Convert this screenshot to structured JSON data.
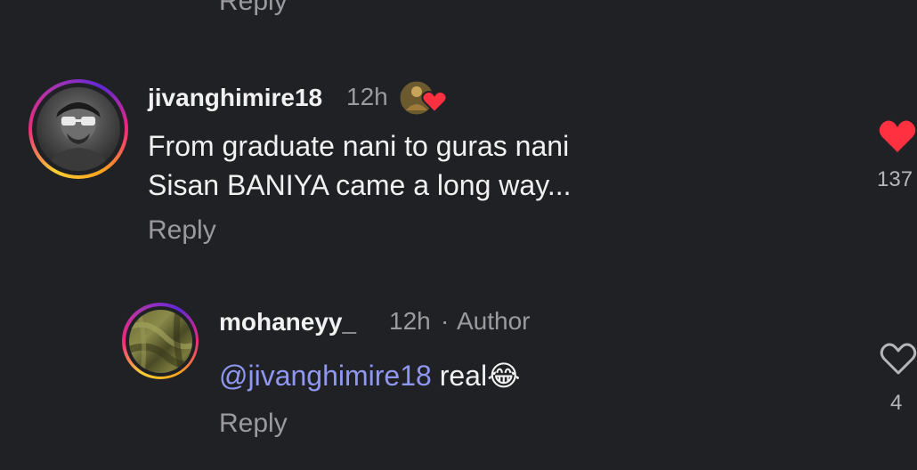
{
  "top": {
    "reply_label": "Reply"
  },
  "comment": {
    "username": "jivanghimire18",
    "time": "12h",
    "text_line1": "From graduate nani to guras nani",
    "text_line2": "Sisan BANIYA came a long way...",
    "reply_label": "Reply",
    "like_count": "137",
    "liked": true,
    "heart_color": "#ff3040"
  },
  "reply": {
    "username": "mohaneyy_",
    "time": "12h",
    "separator": "·",
    "author_label": "Author",
    "mention": "@jivanghimire18",
    "text": "real",
    "emoji": "😂",
    "reply_label": "Reply",
    "like_count": "4",
    "liked": false
  },
  "colors": {
    "background": "#202125",
    "mention": "#8f97f0",
    "secondary_text": "#9a9aa0"
  }
}
